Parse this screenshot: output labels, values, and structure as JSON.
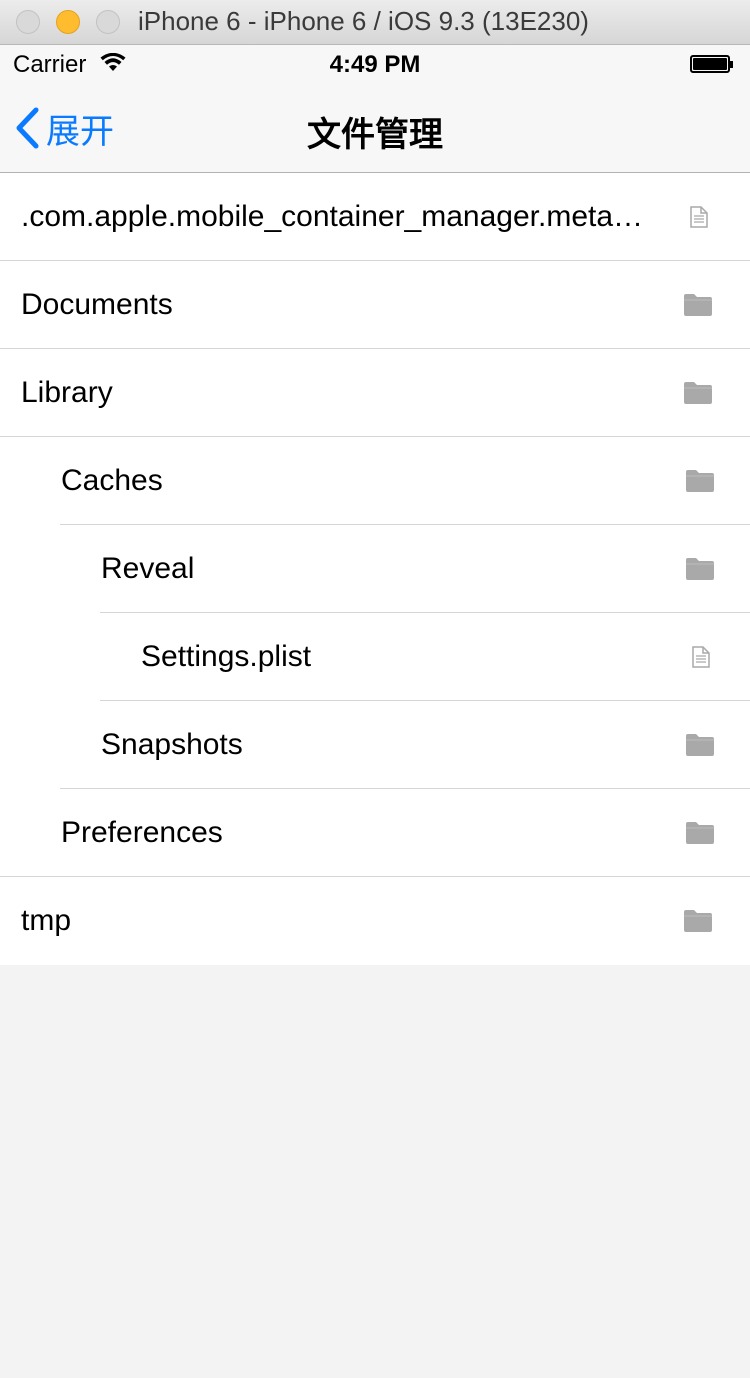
{
  "window": {
    "title": "iPhone 6 - iPhone 6 / iOS 9.3 (13E230)"
  },
  "status_bar": {
    "carrier": "Carrier",
    "time": "4:49 PM"
  },
  "nav_bar": {
    "back_label": "展开",
    "title": "文件管理"
  },
  "files": [
    {
      "name": ".com.apple.mobile_container_manager.metadata.plist",
      "type": "file",
      "depth": 0
    },
    {
      "name": "Documents",
      "type": "folder",
      "depth": 0
    },
    {
      "name": "Library",
      "type": "folder",
      "depth": 0
    },
    {
      "name": "Caches",
      "type": "folder",
      "depth": 1
    },
    {
      "name": "Reveal",
      "type": "folder",
      "depth": 2
    },
    {
      "name": "Settings.plist",
      "type": "file",
      "depth": 3
    },
    {
      "name": "Snapshots",
      "type": "folder",
      "depth": 2
    },
    {
      "name": "Preferences",
      "type": "folder",
      "depth": 1
    },
    {
      "name": "tmp",
      "type": "folder",
      "depth": 0
    }
  ],
  "colors": {
    "accent": "#0a7aff",
    "icon_gray": "#a9a9a9"
  }
}
